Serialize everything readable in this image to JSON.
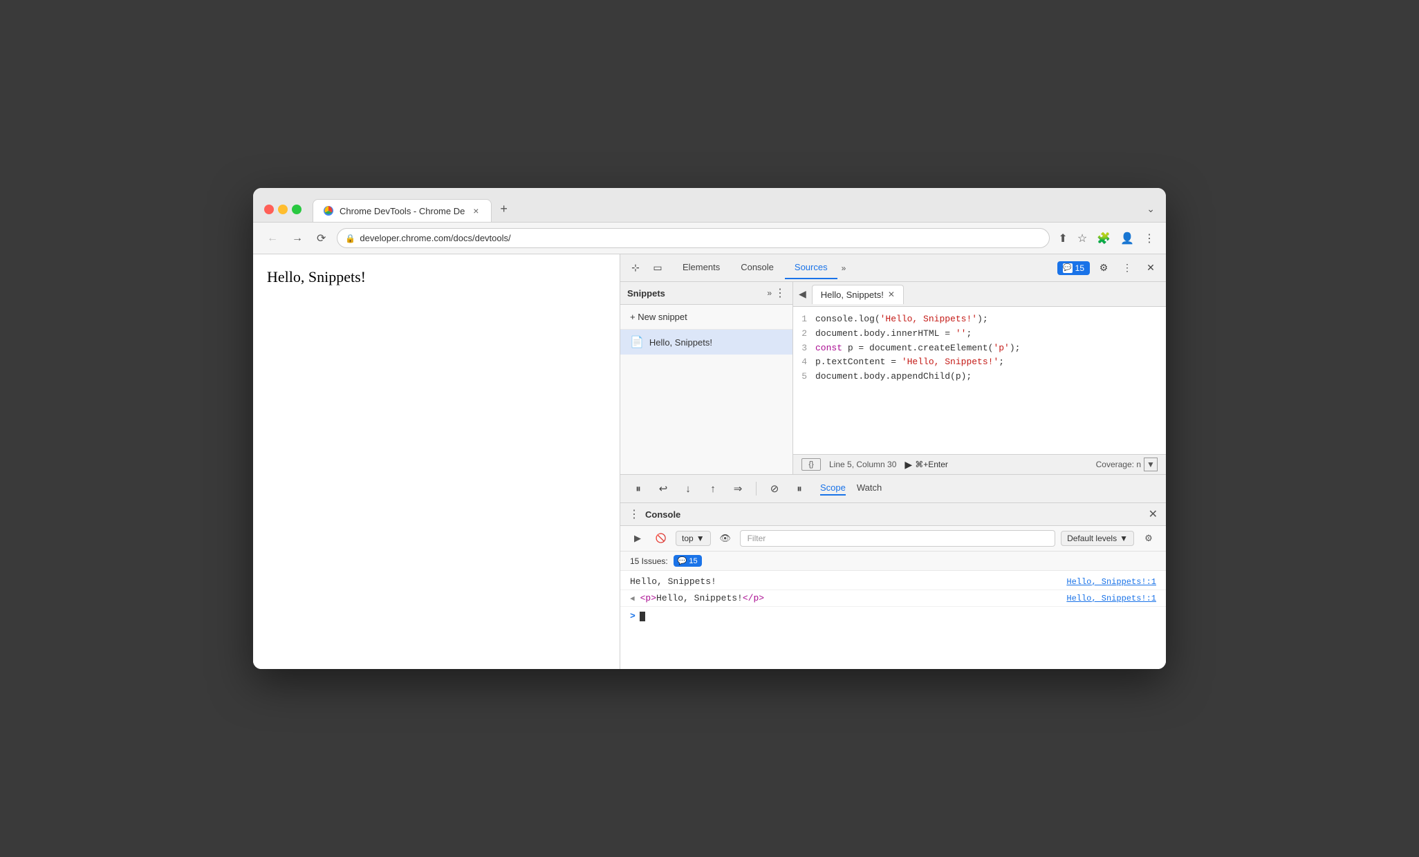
{
  "browser": {
    "tab_title": "Chrome DevTools - Chrome De",
    "tab_close": "×",
    "tab_new": "+",
    "tab_chevron": "⌄",
    "url": "developer.chrome.com/docs/devtools/",
    "page_text": "Hello, Snippets!"
  },
  "devtools": {
    "tabs": [
      "Elements",
      "Console",
      "Sources"
    ],
    "active_tab": "Sources",
    "issues_count": "15",
    "settings_icon": "⚙",
    "more_icon": "⋮",
    "close_icon": "×"
  },
  "sources": {
    "sidebar_title": "Snippets",
    "new_snippet_label": "+ New snippet",
    "snippet_name": "Hello, Snippets!",
    "editor_tab": "Hello, Snippets!",
    "back_icon": "◀",
    "code_lines": [
      {
        "num": 1,
        "code": "console.log('Hello, Snippets!');"
      },
      {
        "num": 2,
        "code": "document.body.innerHTML = '';"
      },
      {
        "num": 3,
        "code": "const p = document.createElement('p');"
      },
      {
        "num": 4,
        "code": "p.textContent = 'Hello, Snippets!';"
      },
      {
        "num": 5,
        "code": "document.body.appendChild(p);"
      }
    ],
    "status_line": "Line 5, Column 30",
    "run_label": "⌘+Enter",
    "coverage_label": "Coverage: n"
  },
  "debugger": {
    "scope_tab": "Scope",
    "watch_tab": "Watch"
  },
  "console": {
    "title": "Console",
    "context": "top",
    "filter_placeholder": "Filter",
    "levels": "Default levels",
    "issues_label": "15 Issues:",
    "issues_count": "15",
    "log_output": "Hello, Snippets!",
    "log_source": "Hello, Snippets!:1",
    "dom_output": "<p>Hello, Snippets!</p>",
    "dom_source": "Hello, Snippets!:1"
  }
}
